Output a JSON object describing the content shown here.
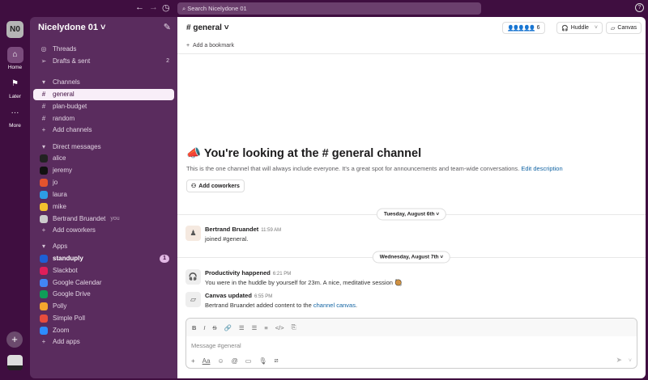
{
  "topbar": {
    "search_placeholder": "Search Nicelydone 01",
    "back": "←",
    "forward": "→",
    "history": "◷",
    "help": "?"
  },
  "rail": {
    "workspace_initials": "N0",
    "items": [
      {
        "label": "Home"
      },
      {
        "label": "Later"
      },
      {
        "label": "More"
      }
    ]
  },
  "sidebar": {
    "workspace_name": "Nicelydone 01 ˅",
    "top_items": [
      {
        "label": "Threads"
      },
      {
        "label": "Drafts & sent",
        "count": "2"
      }
    ],
    "channels_header": "Channels",
    "channels": [
      {
        "label": "general"
      },
      {
        "label": "plan-budget"
      },
      {
        "label": "random"
      }
    ],
    "add_channels": "Add channels",
    "dm_header": "Direct messages",
    "dms": [
      {
        "label": "alice",
        "color": "#222"
      },
      {
        "label": "jeremy",
        "color": "#111"
      },
      {
        "label": "jo",
        "color": "#e5532d"
      },
      {
        "label": "laura",
        "color": "#2d9de5"
      },
      {
        "label": "mike",
        "color": "#f2c12e"
      },
      {
        "label": "Bertrand Bruandet",
        "you": "you",
        "color": "#444"
      }
    ],
    "add_coworkers": "Add coworkers",
    "apps_header": "Apps",
    "apps": [
      {
        "label": "standuply",
        "badge": "1",
        "color": "#1d5fd6"
      },
      {
        "label": "Slackbot",
        "color": "#e01e5a"
      },
      {
        "label": "Google Calendar",
        "color": "#4285f4"
      },
      {
        "label": "Google Drive",
        "color": "#0f9d58"
      },
      {
        "label": "Polly",
        "color": "#f4a52e"
      },
      {
        "label": "Simple Poll",
        "color": "#e84c3d"
      },
      {
        "label": "Zoom",
        "color": "#2d8cff"
      }
    ],
    "add_apps": "Add apps"
  },
  "header": {
    "channel": "# general ˅",
    "member_count": "6",
    "huddle": "Huddle",
    "canvas": "Canvas",
    "bookmark": "Add a bookmark"
  },
  "intro": {
    "title_prefix": "You're looking at the ",
    "title_channel": "# general",
    "title_suffix": " channel",
    "description": "This is the one channel that will always include everyone. It's a great spot for announcements and team-wide conversations.",
    "edit": "Edit description",
    "add_coworkers": "Add coworkers"
  },
  "dates": [
    "Tuesday, August 6th ˅",
    "Wednesday, August 7th ˅"
  ],
  "messages": [
    {
      "name": "Bertrand Bruandet",
      "time": "11:59 AM",
      "text": "joined #general."
    },
    {
      "name": "Productivity happened",
      "time": "6:21 PM",
      "text": "You were in the huddle by yourself for 23m. A nice, meditative session 🥘"
    },
    {
      "name": "Canvas updated",
      "time": "6:55 PM",
      "text": "Bertrand Bruandet added content to the ",
      "link": "channel canvas",
      "after": "."
    }
  ],
  "composer": {
    "placeholder": "Message #general"
  }
}
